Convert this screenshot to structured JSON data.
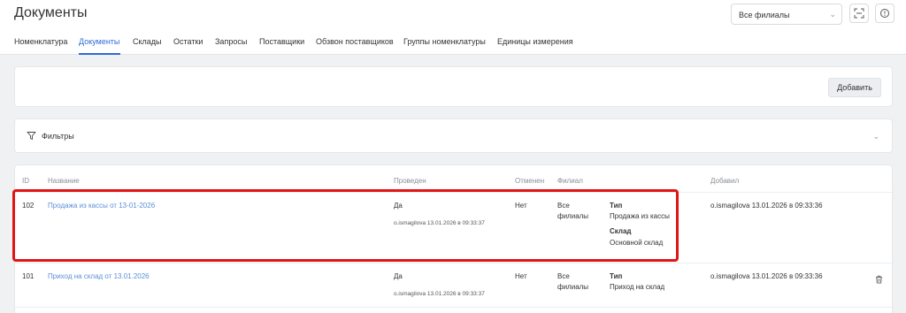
{
  "header": {
    "title": "Документы",
    "branch_select": "Все филиалы"
  },
  "nav": {
    "items": [
      {
        "label": "Номенклатура"
      },
      {
        "label": "Документы"
      },
      {
        "label": "Склады"
      },
      {
        "label": "Остатки"
      },
      {
        "label": "Запросы"
      },
      {
        "label": "Поставщики"
      },
      {
        "label": "Обзвон поставщиков"
      },
      {
        "label": "Группы номенклатуры"
      },
      {
        "label": "Единицы измерения"
      }
    ],
    "active": "Документы"
  },
  "toolbar": {
    "add_label": "Добавить"
  },
  "filters": {
    "label": "Фильтры"
  },
  "table": {
    "headers": [
      "ID",
      "Название",
      "Проведен",
      "Отменен",
      "Филиал",
      "Добавил"
    ],
    "rows": [
      {
        "id": "102",
        "name": "Продажа из кассы от 13-01-2026",
        "posted": "Да",
        "posted_by": "o.ismagilova 13.01.2026 в 09:33:37",
        "cancelled": "Нет",
        "branch_line1": "Все",
        "branch_line2": "филиалы",
        "type_label": "Тип",
        "type_value": "Продажа из кассы",
        "warehouse_label": "Склад",
        "warehouse_value": "Основной склад",
        "added_by": "o.ismagilova 13.01.2026 в 09:33:36"
      },
      {
        "id": "101",
        "name": "Приход на склад от 13.01.2026",
        "posted": "Да",
        "posted_by": "o.ismagilova 13.01.2026 в 09:33:37",
        "cancelled": "Нет",
        "branch_line1": "Все",
        "branch_line2": "филиалы",
        "type_label": "Тип",
        "type_value": "Приход на склад",
        "added_by": "o.ismagilova 13.01.2026 в 09:33:36"
      }
    ]
  },
  "colors": {
    "accent": "#2f6bd8",
    "link": "#5b8fd8",
    "highlight": "#e01616"
  }
}
